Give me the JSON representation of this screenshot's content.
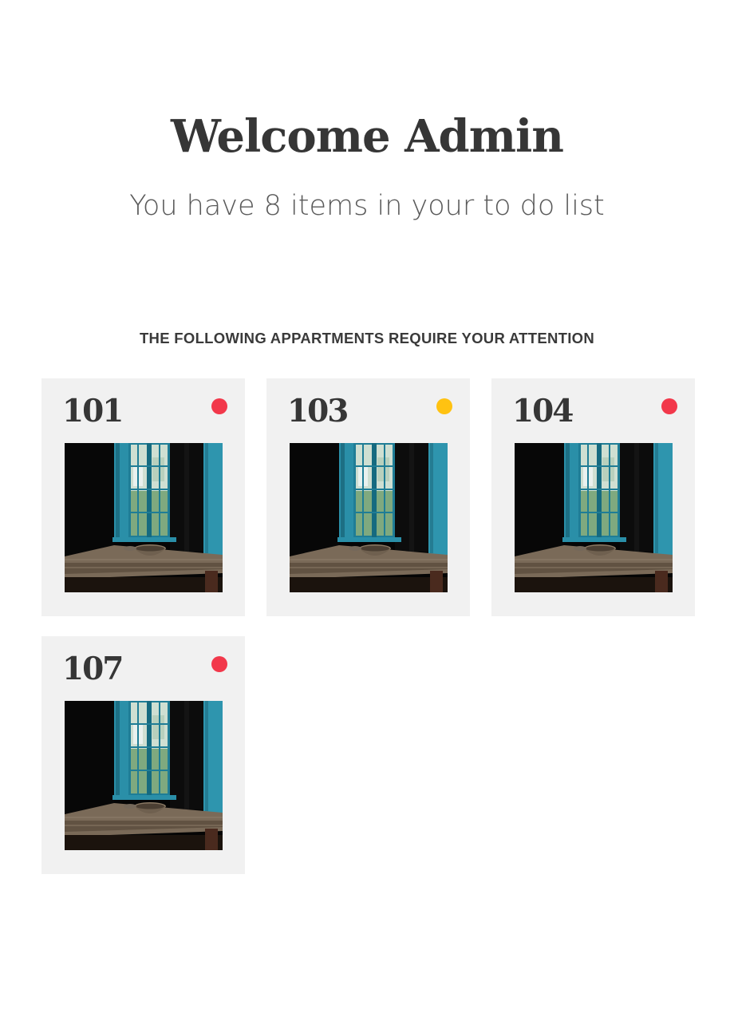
{
  "header": {
    "title": "Welcome Admin",
    "subtitle": "You have 8 items in your to do list"
  },
  "section": {
    "heading": "THE FOLLOWING APPARTMENTS REQUIRE YOUR ATTENTION"
  },
  "apartments": [
    {
      "number": "101",
      "status_color": "#f2384b",
      "photo": "apartment-photo"
    },
    {
      "number": "103",
      "status_color": "#ffc211",
      "photo": "apartment-photo"
    },
    {
      "number": "104",
      "status_color": "#f2384b",
      "photo": "apartment-photo"
    },
    {
      "number": "107",
      "status_color": "#f2384b",
      "photo": "apartment-photo"
    }
  ]
}
